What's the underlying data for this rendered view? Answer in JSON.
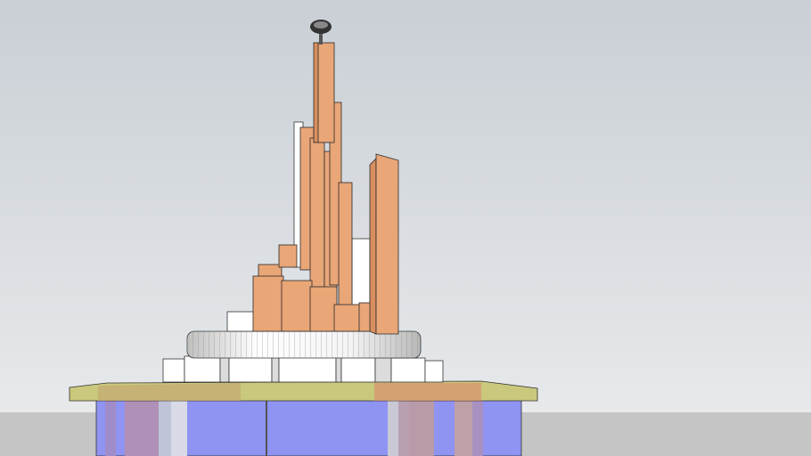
{
  "scene": {
    "colors": {
      "sky_top": "#c9cfd5",
      "sky_bottom": "#e7e9eb",
      "ground": "#c5c5c5",
      "tower": "#e9a677",
      "base_blue": "#8f93f2",
      "slab": "#c9c87c"
    }
  }
}
